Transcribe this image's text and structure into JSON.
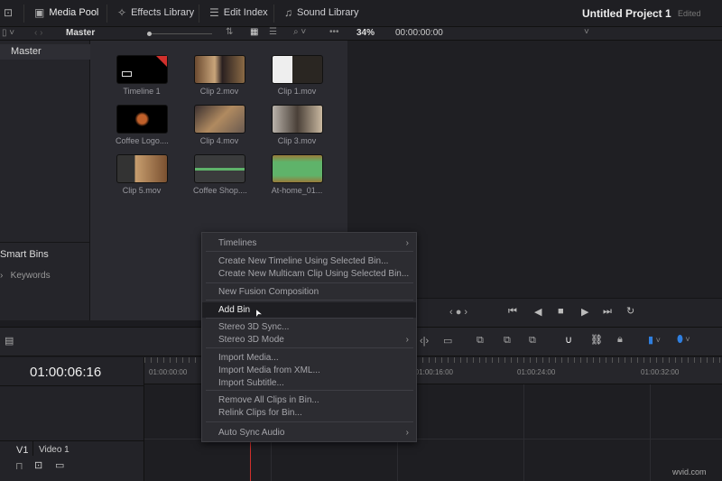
{
  "topbar": {
    "tabs": [
      {
        "label": "Media Pool",
        "icon": "media-pool-icon"
      },
      {
        "label": "Effects Library",
        "icon": "effects-icon"
      },
      {
        "label": "Edit Index",
        "icon": "list-icon"
      },
      {
        "label": "Sound Library",
        "icon": "music-icon"
      }
    ],
    "project_title": "Untitled Project 1",
    "project_status": "Edited"
  },
  "toolbar": {
    "bin_name": "Master",
    "zoom": "34%",
    "timecode": "00:00:00:00"
  },
  "bins": {
    "master": "Master",
    "smart_bins": "Smart Bins",
    "keywords": "Keywords"
  },
  "clips": [
    {
      "name": "Timeline 1",
      "kind": "timeline"
    },
    {
      "name": "Clip 2.mov",
      "kind": "video"
    },
    {
      "name": "Clip 1.mov",
      "kind": "video"
    },
    {
      "name": "Coffee Logo....",
      "kind": "video"
    },
    {
      "name": "Clip 4.mov",
      "kind": "video"
    },
    {
      "name": "Clip 3.mov",
      "kind": "video"
    },
    {
      "name": "Clip 5.mov",
      "kind": "video"
    },
    {
      "name": "Coffee Shop....",
      "kind": "audio"
    },
    {
      "name": "At-home_01...",
      "kind": "audio"
    }
  ],
  "context_menu": {
    "items": [
      "Timelines",
      "Create New Timeline Using Selected Bin...",
      "Create New Multicam Clip Using Selected Bin...",
      "New Fusion Composition",
      "Add Bin",
      "Stereo 3D Sync...",
      "Stereo 3D Mode",
      "Import Media...",
      "Import Media from XML...",
      "Import Subtitle...",
      "Remove All Clips in Bin...",
      "Relink Clips for Bin...",
      "Auto Sync Audio"
    ],
    "highlighted": "Add Bin"
  },
  "timeline": {
    "timecode": "01:00:06:16",
    "ruler": [
      "01:00:00:00",
      "01:00:16:00",
      "01:00:24:00",
      "01:00:32:00"
    ],
    "track_id": "V1",
    "track_name": "Video 1"
  },
  "colors": {
    "playhead": "#d0302c",
    "accent": "#2f7fe0",
    "audio_wave": "#5fb36a"
  },
  "watermark": "wvid.com"
}
